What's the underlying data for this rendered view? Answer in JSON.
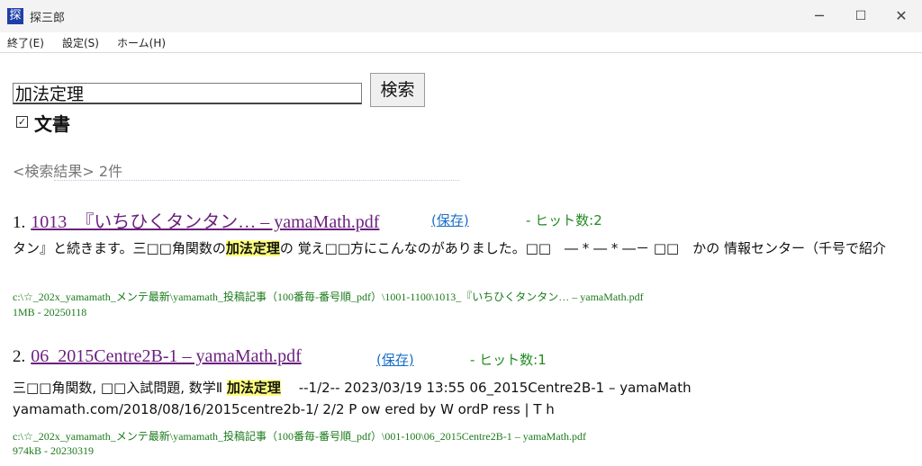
{
  "window": {
    "app_icon_char": "探",
    "title": "探三郎",
    "minimize_glyph": "─",
    "maximize_glyph": "☐",
    "close_glyph": "✕"
  },
  "menu": [
    "終了(E)",
    "設定(S)",
    "ホーム(H)"
  ],
  "search": {
    "query": "加法定理",
    "button_label": "検索",
    "checkbox_checked": true,
    "checkbox_label": "文書"
  },
  "results_summary": "<検索結果>  2件",
  "results": [
    {
      "number": "1.",
      "title": "1013_『いちひくタンタン… – yamaMath.pdf",
      "save_label": "(保存)",
      "hits": "- ヒット数:2",
      "snippet_before": "タン』と続きます。三□□角関数の",
      "snippet_highlight": "加法定理",
      "snippet_after": "の 覚え□□方にこんなのがありました。□□　― * ― * ―－ □□　かの 情報センター（千号で紹介",
      "path": "c:\\☆_202x_yamamath_メンテ最新\\yamamath_投稿記事（100番毎-番号順_pdf）\\1001-1100\\1013_『いちひくタンタン… – yamaMath.pdf",
      "meta": "1MB - 20250118"
    },
    {
      "number": "2.",
      "title": "06_2015Centre2B-1 – yamaMath.pdf",
      "save_label": "(保存)",
      "hits": "- ヒット数:1",
      "snippet_before": "三□□角関数, □□入試問題, 数学Ⅱ ",
      "snippet_highlight": "加法定理",
      "snippet_after": "　 --1/2-- 2023/03/19 13:55 06_2015Centre2B-1 – yamaMath yamamath.com/2018/08/16/2015centre2b-1/ 2/2 P ow ered by W ordP ress | T h",
      "path": "c:\\☆_202x_yamamath_メンテ最新\\yamamath_投稿記事（100番毎-番号順_pdf）\\001-100\\06_2015Centre2B-1 – yamaMath.pdf",
      "meta": "974kB - 20230319"
    }
  ]
}
